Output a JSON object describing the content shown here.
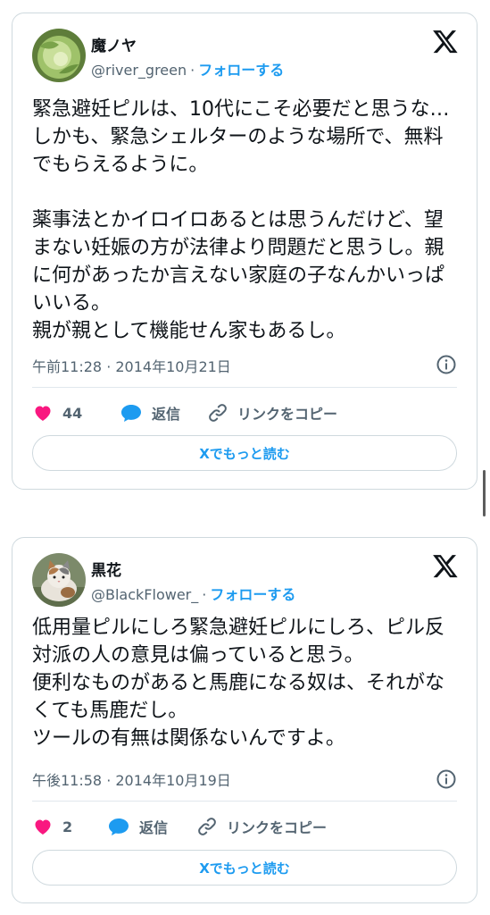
{
  "tweets": [
    {
      "name": "魔ノヤ",
      "handle": "@river_green",
      "separator": "·",
      "follow_label": "フォローする",
      "text": "緊急避妊ピルは、10代にこそ必要だと思うな…しかも、緊急シェルターのような場所で、無料でもらえるように。\n\n薬事法とかイロイロあるとは思うんだけど、望まない妊娠の方が法律より問題だと思うし。親に何があったか言えない家庭の子なんかいっぱいいる。\n親が親として機能せん家もあるし。",
      "timestamp": "午前11:28 · 2014年10月21日",
      "likes": "44",
      "reply_label": "返信",
      "copy_label": "リンクをコピー",
      "read_more_label": "Xでもっと読む",
      "avatar_icon": "cabbage-avatar"
    },
    {
      "name": "黒花",
      "handle": "@BlackFlower_",
      "separator": "·",
      "follow_label": "フォローする",
      "text": "低用量ピルにしろ緊急避妊ピルにしろ、ピル反対派の人の意見は偏っていると思う。\n便利なものがあると馬鹿になる奴は、それがなくても馬鹿だし。\nツールの有無は関係ないんですよ。",
      "timestamp": "午後11:58 · 2014年10月19日",
      "likes": "2",
      "reply_label": "返信",
      "copy_label": "リンクをコピー",
      "read_more_label": "Xでもっと読む",
      "avatar_icon": "cat-avatar"
    }
  ],
  "colors": {
    "accent": "#1d9bf0",
    "like": "#f91880",
    "muted": "#536471",
    "text": "#0f1419",
    "border": "#cfd9de"
  }
}
